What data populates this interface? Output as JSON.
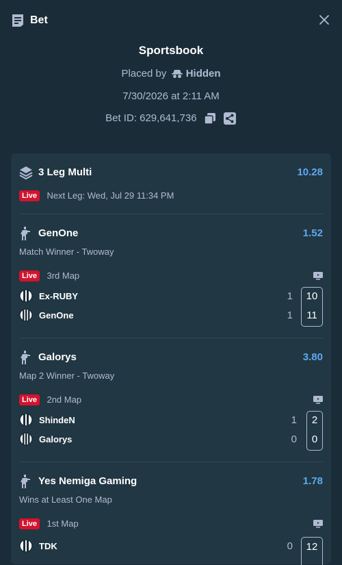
{
  "header": {
    "title": "Bet"
  },
  "info": {
    "heading": "Sportsbook",
    "placed_by_label": "Placed by",
    "placed_by_user": "Hidden",
    "datetime": "7/30/2026 at 2:11 AM",
    "bet_id_label": "Bet ID: 629,641,736"
  },
  "multi": {
    "label": "3 Leg Multi",
    "odds": "10.28",
    "live_badge": "Live",
    "next_leg": "Next Leg: Wed, Jul 29 11:34 PM"
  },
  "legs": [
    {
      "name": "GenOne",
      "odds": "1.52",
      "market": "Match Winner - Twoway",
      "live_badge": "Live",
      "status": "3rd Map",
      "teams": [
        {
          "name": "Ex-RUBY",
          "maps": "1",
          "round": "10"
        },
        {
          "name": "GenOne",
          "maps": "1",
          "round": "11"
        }
      ]
    },
    {
      "name": "Galorys",
      "odds": "3.80",
      "market": "Map 2 Winner - Twoway",
      "live_badge": "Live",
      "status": "2nd Map",
      "teams": [
        {
          "name": "ShindeN",
          "maps": "1",
          "round": "2"
        },
        {
          "name": "Galorys",
          "maps": "0",
          "round": "0"
        }
      ]
    },
    {
      "name": "Yes Nemiga Gaming",
      "odds": "1.78",
      "market": "Wins at Least One Map",
      "live_badge": "Live",
      "status": "1st Map",
      "teams": [
        {
          "name": "TDK",
          "maps": "0",
          "round": "12"
        }
      ]
    }
  ],
  "colors": {
    "background": "#1a2c38",
    "card": "#213743",
    "odds": "#5ea9f0",
    "live": "#d5132e",
    "muted": "#b1bad3"
  },
  "icons": [
    "bet-slip-icon",
    "close-icon",
    "incognito-icon",
    "copy-icon",
    "share-icon",
    "layers-icon",
    "counter-strike-icon",
    "tv-icon",
    "team-logo-icon"
  ]
}
